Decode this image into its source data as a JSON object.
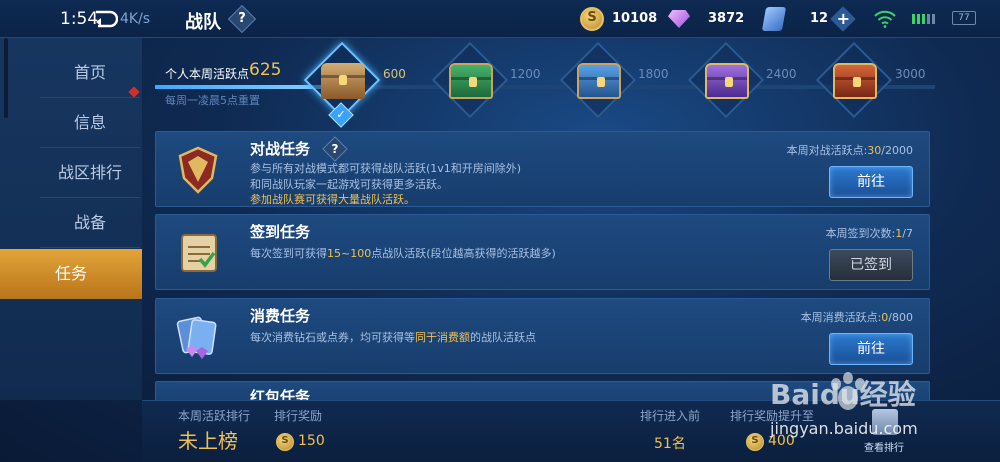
{
  "status": {
    "time": "1:54",
    "net_speed": "4K/s",
    "battery": "77"
  },
  "header": {
    "title": "战队",
    "help_label": "?"
  },
  "currency": {
    "gold": "10108",
    "diamonds": "3872",
    "vouchers": "12",
    "plus_label": "+"
  },
  "sidebar": {
    "items": [
      {
        "label": "首页"
      },
      {
        "label": "信息"
      },
      {
        "label": "战区排行"
      },
      {
        "label": "战备"
      },
      {
        "label": "任务"
      }
    ]
  },
  "progress": {
    "label": "个人本周活跃点",
    "value": "625",
    "reset_note": "每周一凌晨5点重置",
    "current_points": 625,
    "max_points": 3000,
    "milestones": [
      {
        "points": "600",
        "chest": "wood-chest-icon",
        "claimed": true
      },
      {
        "points": "1200",
        "chest": "green-chest-icon",
        "claimed": false
      },
      {
        "points": "1800",
        "chest": "blue-chest-icon",
        "claimed": false
      },
      {
        "points": "2400",
        "chest": "purple-chest-icon",
        "claimed": false
      },
      {
        "points": "3000",
        "chest": "red-chest-icon",
        "claimed": false
      }
    ]
  },
  "tasks": [
    {
      "title": "对战任务",
      "desc1": "参与所有对战模式都可获得战队活跃(1v1和开房间除外)",
      "desc2": "和同战队玩家一起游戏可获得更多活跃。",
      "highlight": "参加战队赛可获得大量战队活跃。",
      "stat_label": "本周对战活跃点:",
      "stat_current": "30",
      "stat_total": "/2000",
      "button": "前往"
    },
    {
      "title": "签到任务",
      "desc_pre": "每次签到可获得",
      "desc_hl": "15~100",
      "desc_post": "点战队活跃(段位越高获得的活跃越多)",
      "stat_label": "本周签到次数:",
      "stat_current": "1",
      "stat_total": "/7",
      "button": "已签到"
    },
    {
      "title": "消费任务",
      "desc_pre": "每次消费钻石或点券，均可获得等",
      "desc_hl": "同于消费额",
      "desc_post": "的战队活跃点",
      "stat_label": "本周消费活跃点:",
      "stat_current": "0",
      "stat_total": "/800",
      "button": "前往"
    },
    {
      "title": "红包任务"
    }
  ],
  "footer": {
    "rank_label": "本周活跃排行",
    "rank_value": "未上榜",
    "reward_label": "排行奖励",
    "reward_value": "150",
    "enter_label": "排行进入前",
    "enter_value": "51名",
    "reward_up_label": "排行奖励提升至",
    "reward_up_value": "400",
    "view_rank": "查看排行"
  },
  "watermark": {
    "brand": "Baidu经验",
    "url": "jingyan.baidu.com"
  }
}
